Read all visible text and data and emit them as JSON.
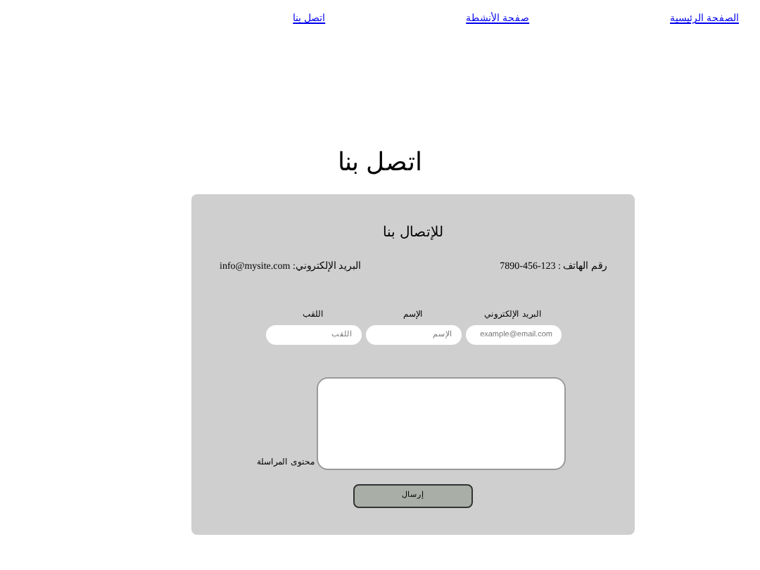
{
  "nav": [
    {
      "label": "الصفحة الرئيسية"
    },
    {
      "label": "صفحة الأنشطة"
    },
    {
      "label": "اتصل بنا"
    }
  ],
  "page_title": "اتصل بنا",
  "card": {
    "heading": "للإتصال بنا",
    "phone": "رقم الهاتف : 123-456-7890",
    "email": "البريد الإلكتروني: info@mysite.com",
    "fields": [
      {
        "label": "البريد الإلكتروني",
        "placeholder": "example@email.com"
      },
      {
        "label": "الإسم",
        "placeholder": "الإسم"
      },
      {
        "label": "اللقب",
        "placeholder": "اللقب"
      }
    ],
    "message_label": "محتوى المراسلة",
    "submit": "إرسال"
  }
}
